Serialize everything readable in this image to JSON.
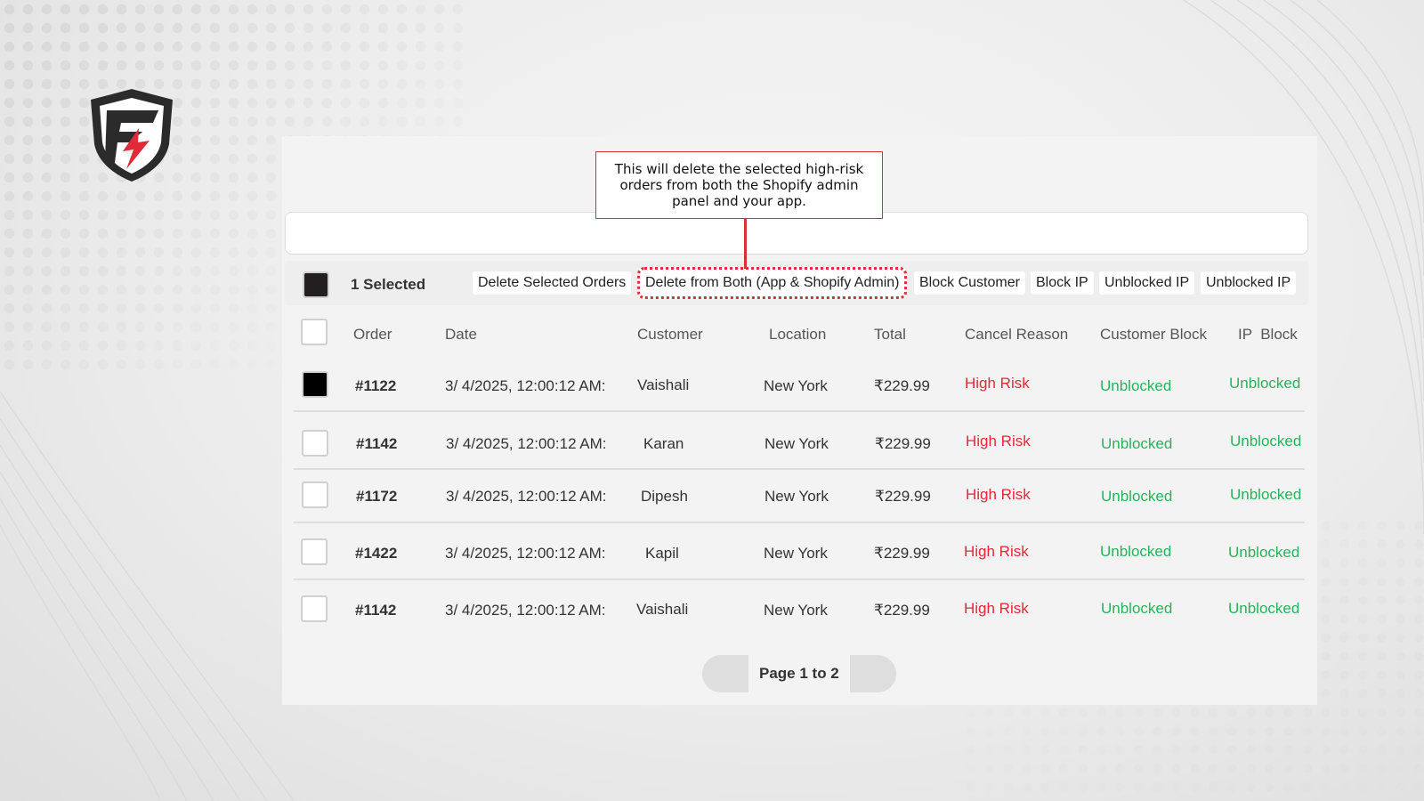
{
  "callout": {
    "text": "This will delete the selected high-risk orders from both the Shopify admin panel and your app."
  },
  "action_bar": {
    "selected_label": "1 Selected",
    "buttons": [
      "Delete Selected Orders",
      "Delete from Both (App & Shopify Admin)",
      "Block Customer",
      "Block IP",
      "Unblocked IP",
      "Unblocked IP"
    ]
  },
  "table": {
    "headers": [
      "Order",
      "Date",
      "Customer",
      "Location",
      "Total",
      "Cancel Reason",
      "Customer Block",
      "IP  Block"
    ],
    "rows": [
      {
        "checked": true,
        "order": "#1122",
        "date": "3/ 4/2025, 12:00:12 AM:",
        "customer": "Vaishali",
        "location": "New York",
        "total": "₹229.99",
        "reason": "High Risk",
        "customer_block": "Unblocked",
        "ip_block": "Unblocked"
      },
      {
        "checked": false,
        "order": "#1142",
        "date": "3/ 4/2025, 12:00:12 AM:",
        "customer": "Karan",
        "location": "New York",
        "total": "₹229.99",
        "reason": "High Risk",
        "customer_block": "Unblocked",
        "ip_block": "Unblocked"
      },
      {
        "checked": false,
        "order": "#1172",
        "date": "3/ 4/2025, 12:00:12 AM:",
        "customer": "Dipesh",
        "location": "New York",
        "total": "₹229.99",
        "reason": "High Risk",
        "customer_block": "Unblocked",
        "ip_block": "Unblocked"
      },
      {
        "checked": false,
        "order": "#1422",
        "date": "3/ 4/2025, 12:00:12 AM:",
        "customer": "Kapil",
        "location": "New York",
        "total": "₹229.99",
        "reason": "High Risk",
        "customer_block": "Unblocked",
        "ip_block": "Unblocked"
      },
      {
        "checked": false,
        "order": "#1142",
        "date": "3/ 4/2025, 12:00:12 AM:",
        "customer": "Vaishali",
        "location": "New York",
        "total": "₹229.99",
        "reason": "High Risk",
        "customer_block": "Unblocked",
        "ip_block": "Unblocked"
      }
    ]
  },
  "pagination": {
    "label": "Page 1 to 2"
  },
  "logo": {
    "letter": "F"
  },
  "colors": {
    "accent_red": "#d8303a",
    "status_green": "#27b35a",
    "risk_red": "#e02a38"
  }
}
